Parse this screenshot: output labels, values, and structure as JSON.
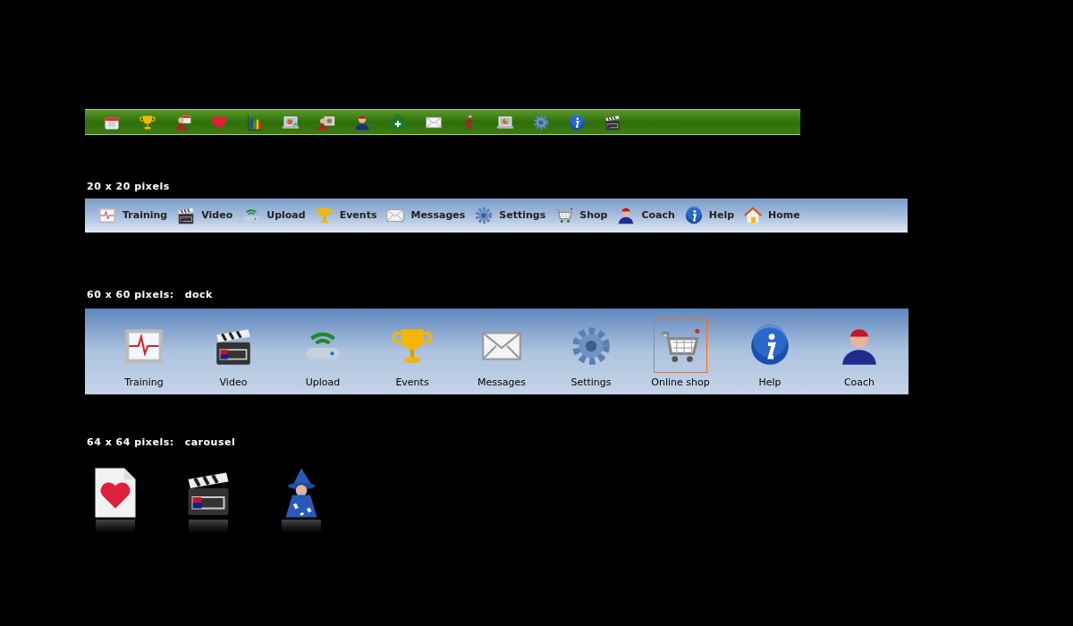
{
  "green_toolbar": {
    "icons": [
      {
        "kind": "calendar"
      },
      {
        "kind": "trophy"
      },
      {
        "kind": "person-calendar"
      },
      {
        "kind": "heart"
      },
      {
        "kind": "bar-chart"
      },
      {
        "kind": "laptop-refresh"
      },
      {
        "kind": "person-laptop"
      },
      {
        "kind": "person"
      },
      {
        "kind": "first-aid"
      },
      {
        "kind": "envelope"
      },
      {
        "kind": "runner"
      },
      {
        "kind": "laptop-chart"
      },
      {
        "kind": "gear"
      },
      {
        "kind": "info"
      },
      {
        "kind": "clapperboard"
      }
    ]
  },
  "small_toolbar": {
    "heading": "20 x 20 pixels",
    "items": [
      {
        "kind": "ecg",
        "label": "Training"
      },
      {
        "kind": "clapperboard",
        "label": "Video"
      },
      {
        "kind": "router",
        "label": "Upload"
      },
      {
        "kind": "trophy",
        "label": "Events"
      },
      {
        "kind": "envelope",
        "label": "Messages"
      },
      {
        "kind": "gear",
        "label": "Settings"
      },
      {
        "kind": "cart",
        "label": "Shop"
      },
      {
        "kind": "person",
        "label": "Coach"
      },
      {
        "kind": "info",
        "label": "Help"
      },
      {
        "kind": "house",
        "label": "Home"
      }
    ]
  },
  "dock": {
    "heading": "60 x 60 pixels:",
    "style": "dock",
    "items": [
      {
        "kind": "ecg",
        "label": "Training",
        "selected": false
      },
      {
        "kind": "clapperboard",
        "label": "Video",
        "selected": false
      },
      {
        "kind": "router",
        "label": "Upload",
        "selected": false
      },
      {
        "kind": "trophy",
        "label": "Events",
        "selected": false
      },
      {
        "kind": "envelope",
        "label": "Messages",
        "selected": false
      },
      {
        "kind": "gear",
        "label": "Settings",
        "selected": false
      },
      {
        "kind": "cart",
        "label": "Online shop",
        "selected": true
      },
      {
        "kind": "info",
        "label": "Help",
        "selected": false
      },
      {
        "kind": "person",
        "label": "Coach",
        "selected": false
      }
    ]
  },
  "carousel": {
    "heading": "64 x 64 pixels:",
    "style": "carousel",
    "icons": [
      {
        "kind": "heart-document"
      },
      {
        "kind": "clapperboard"
      },
      {
        "kind": "wizard"
      }
    ]
  }
}
